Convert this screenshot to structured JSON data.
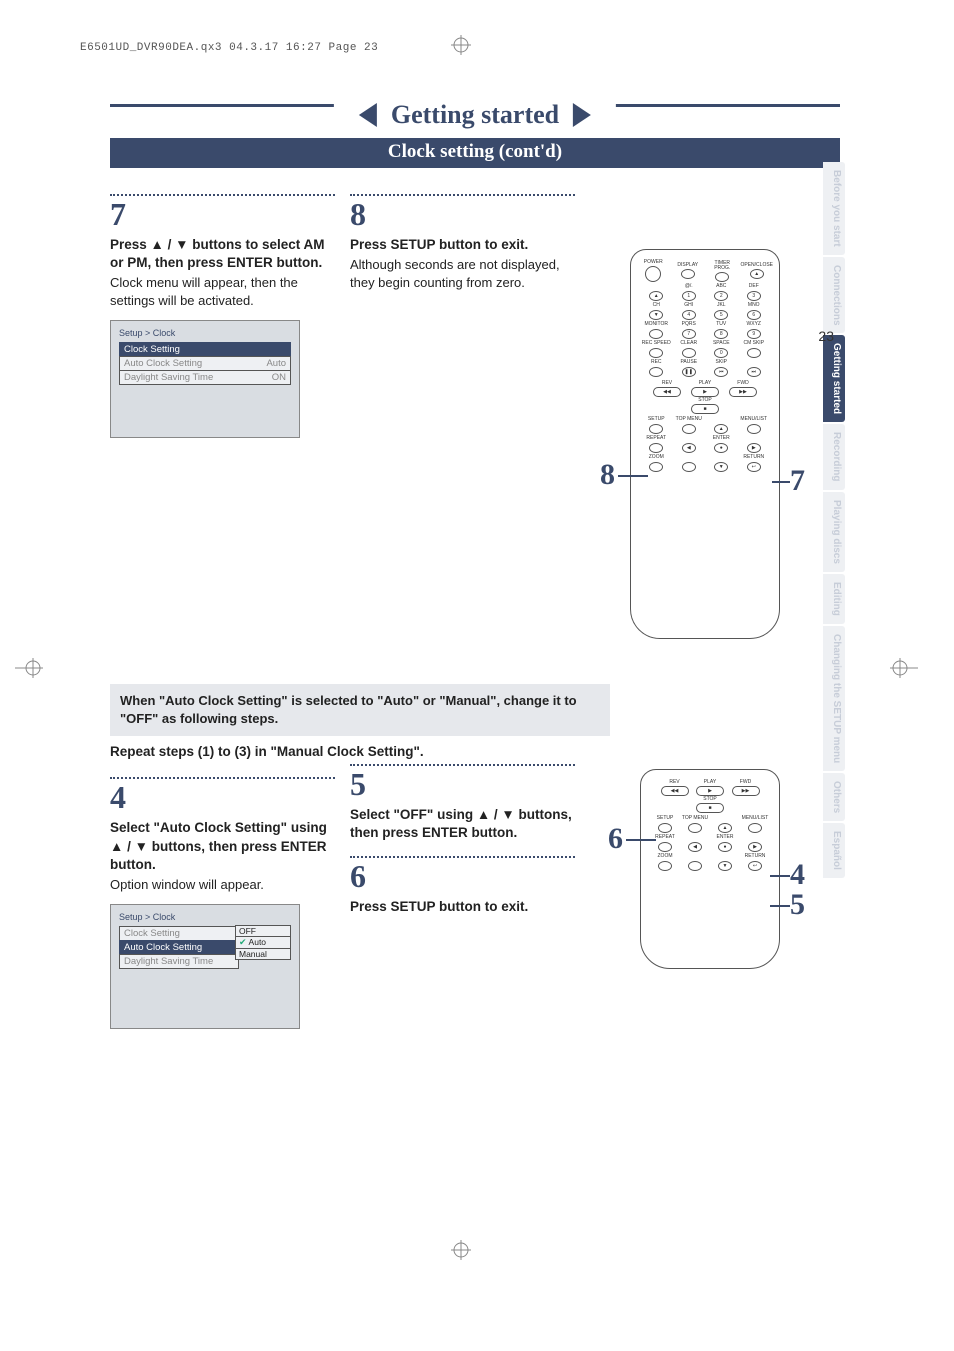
{
  "header_line": "E6501UD_DVR90DEA.qx3  04.3.17  16:27  Page 23",
  "banner_title": "Getting started",
  "subbanner": "Clock setting (cont'd)",
  "step7": {
    "num": "7",
    "bold": "Press ▲ / ▼ buttons to select AM or PM, then press ENTER button.",
    "body": "Clock menu will appear, then the settings will be activated."
  },
  "step8": {
    "num": "8",
    "bold": "Press SETUP button to exit.",
    "body": "Although seconds are not displayed, they begin counting from zero."
  },
  "menu1": {
    "crumb": "Setup > Clock",
    "rows": [
      {
        "label": "Clock Setting",
        "value": "",
        "sel": true
      },
      {
        "label": "Auto Clock Setting",
        "value": "Auto"
      },
      {
        "label": "Daylight Saving Time",
        "value": "ON"
      }
    ]
  },
  "note_box": "When \"Auto Clock Setting\" is selected to \"Auto\" or \"Manual\", change it to \"OFF\" as following steps.",
  "section2_sub": "Repeat steps (1) to (3) in \"Manual Clock Setting\".",
  "step4": {
    "num": "4",
    "bold": "Select \"Auto Clock Setting\" using ▲ / ▼ buttons, then press ENTER button.",
    "body": "Option window will appear."
  },
  "step5": {
    "num": "5",
    "bold": "Select \"OFF\" using ▲ / ▼ buttons, then press ENTER button."
  },
  "step6": {
    "num": "6",
    "bold": "Press SETUP button to exit."
  },
  "menu2": {
    "crumb": "Setup > Clock",
    "rows": [
      {
        "label": "Clock Setting",
        "value": ""
      },
      {
        "label": "Auto Clock Setting",
        "value": "",
        "sel": true
      },
      {
        "label": "Daylight Saving Time",
        "value": ""
      }
    ],
    "options": [
      "OFF",
      "Auto",
      "Manual"
    ],
    "options_selected": "Auto"
  },
  "remote_labels": {
    "top": [
      "POWER",
      "DISPLAY",
      "TIMER PROG.",
      "OPEN/CLOSE"
    ],
    "keypad": [
      {
        "t": "",
        "n": "▲"
      },
      {
        "t": "@/.",
        "n": "1"
      },
      {
        "t": "ABC",
        "n": "2"
      },
      {
        "t": "DEF",
        "n": "3"
      },
      {
        "t": "CH",
        "n": "▼"
      },
      {
        "t": "GHI",
        "n": "4"
      },
      {
        "t": "JKL",
        "n": "5"
      },
      {
        "t": "MNO",
        "n": "6"
      },
      {
        "t": "MONITOR",
        "n": ""
      },
      {
        "t": "PQRS",
        "n": "7"
      },
      {
        "t": "TUV",
        "n": "8"
      },
      {
        "t": "WXYZ",
        "n": "9"
      },
      {
        "t": "REC SPEED",
        "n": ""
      },
      {
        "t": "CLEAR",
        "n": ""
      },
      {
        "t": "SPACE",
        "n": "0"
      },
      {
        "t": "CM SKIP",
        "n": ""
      },
      {
        "t": "REC",
        "n": ""
      },
      {
        "t": "PAUSE",
        "n": "❚❚"
      },
      {
        "t": "SKIP",
        "n": "⏮"
      },
      {
        "t": "",
        "n": "⏭"
      }
    ],
    "play": "PLAY",
    "rev": "REV",
    "fwd": "FWD",
    "stop": "STOP",
    "nav": [
      {
        "t": "SETUP"
      },
      {
        "t": "TOP MENU"
      },
      {
        "t": "",
        "arrow": "▲"
      },
      {
        "t": "MENU/LIST"
      },
      {
        "t": "REPEAT"
      },
      {
        "t": "",
        "arrow": "◀"
      },
      {
        "t": "ENTER",
        "arrow": "●"
      },
      {
        "t": "",
        "arrow": "▶"
      },
      {
        "t": "ZOOM"
      },
      {
        "t": ""
      },
      {
        "t": "",
        "arrow": "▼"
      },
      {
        "t": "RETURN",
        "arrow": "↩"
      }
    ]
  },
  "callouts": {
    "c8": "8",
    "c7": "7",
    "c6": "6",
    "c4": "4",
    "c5": "5"
  },
  "side_tabs": [
    {
      "label": "Before you start"
    },
    {
      "label": "Connections"
    },
    {
      "label": "Getting started",
      "active": true
    },
    {
      "label": "Recording"
    },
    {
      "label": "Playing discs"
    },
    {
      "label": "Editing"
    },
    {
      "label": "Changing the SETUP menu"
    },
    {
      "label": "Others"
    },
    {
      "label": "Español"
    }
  ],
  "page_number": "23"
}
